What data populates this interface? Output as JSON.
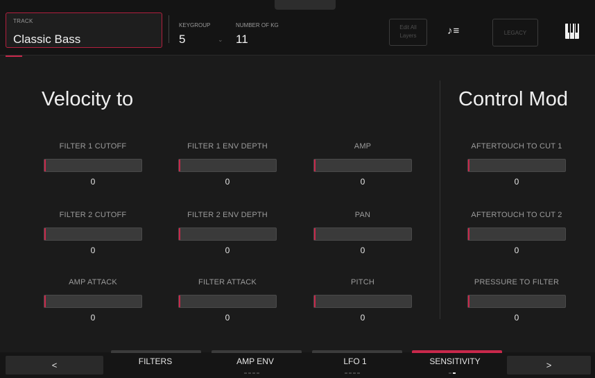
{
  "header": {
    "track_label": "TRACK",
    "track_value": "Classic Bass",
    "keygroup_label": "KEYGROUP",
    "keygroup_value": "5",
    "num_kg_label": "NUMBER OF KG",
    "num_kg_value": "11",
    "edit_all_label": "Edit All\nLayers",
    "legacy_label": "LEGACY"
  },
  "sections": {
    "velocity_title": "Velocity to",
    "control_title": "Control Mod"
  },
  "params": [
    {
      "label": "FILTER 1 CUTOFF",
      "value": "0",
      "level": 0
    },
    {
      "label": "FILTER 1 ENV DEPTH",
      "value": "0",
      "level": 0
    },
    {
      "label": "AMP",
      "value": "0",
      "level": 0
    },
    {
      "label": "AFTERTOUCH TO CUT 1",
      "value": "0",
      "level": 0
    },
    {
      "label": "FILTER 2 CUTOFF",
      "value": "0",
      "level": 0
    },
    {
      "label": "FILTER 2 ENV DEPTH",
      "value": "0",
      "level": 0
    },
    {
      "label": "PAN",
      "value": "0",
      "level": 0
    },
    {
      "label": "AFTERTOUCH TO CUT 2",
      "value": "0",
      "level": 0
    },
    {
      "label": "AMP ATTACK",
      "value": "0",
      "level": 0
    },
    {
      "label": "FILTER ATTACK",
      "value": "0",
      "level": 0
    },
    {
      "label": "PITCH",
      "value": "0",
      "level": 0
    },
    {
      "label": "PRESSURE TO FILTER",
      "value": "0",
      "level": 0
    }
  ],
  "bottom": {
    "prev": "<",
    "next": ">",
    "tabs": [
      "FILTERS",
      "AMP ENV",
      "LFO 1",
      "SENSITIVITY"
    ],
    "active_tab": "SENSITIVITY"
  },
  "colors": {
    "accent": "#c8284b",
    "background": "#1b1b1b",
    "header": "#141414"
  }
}
